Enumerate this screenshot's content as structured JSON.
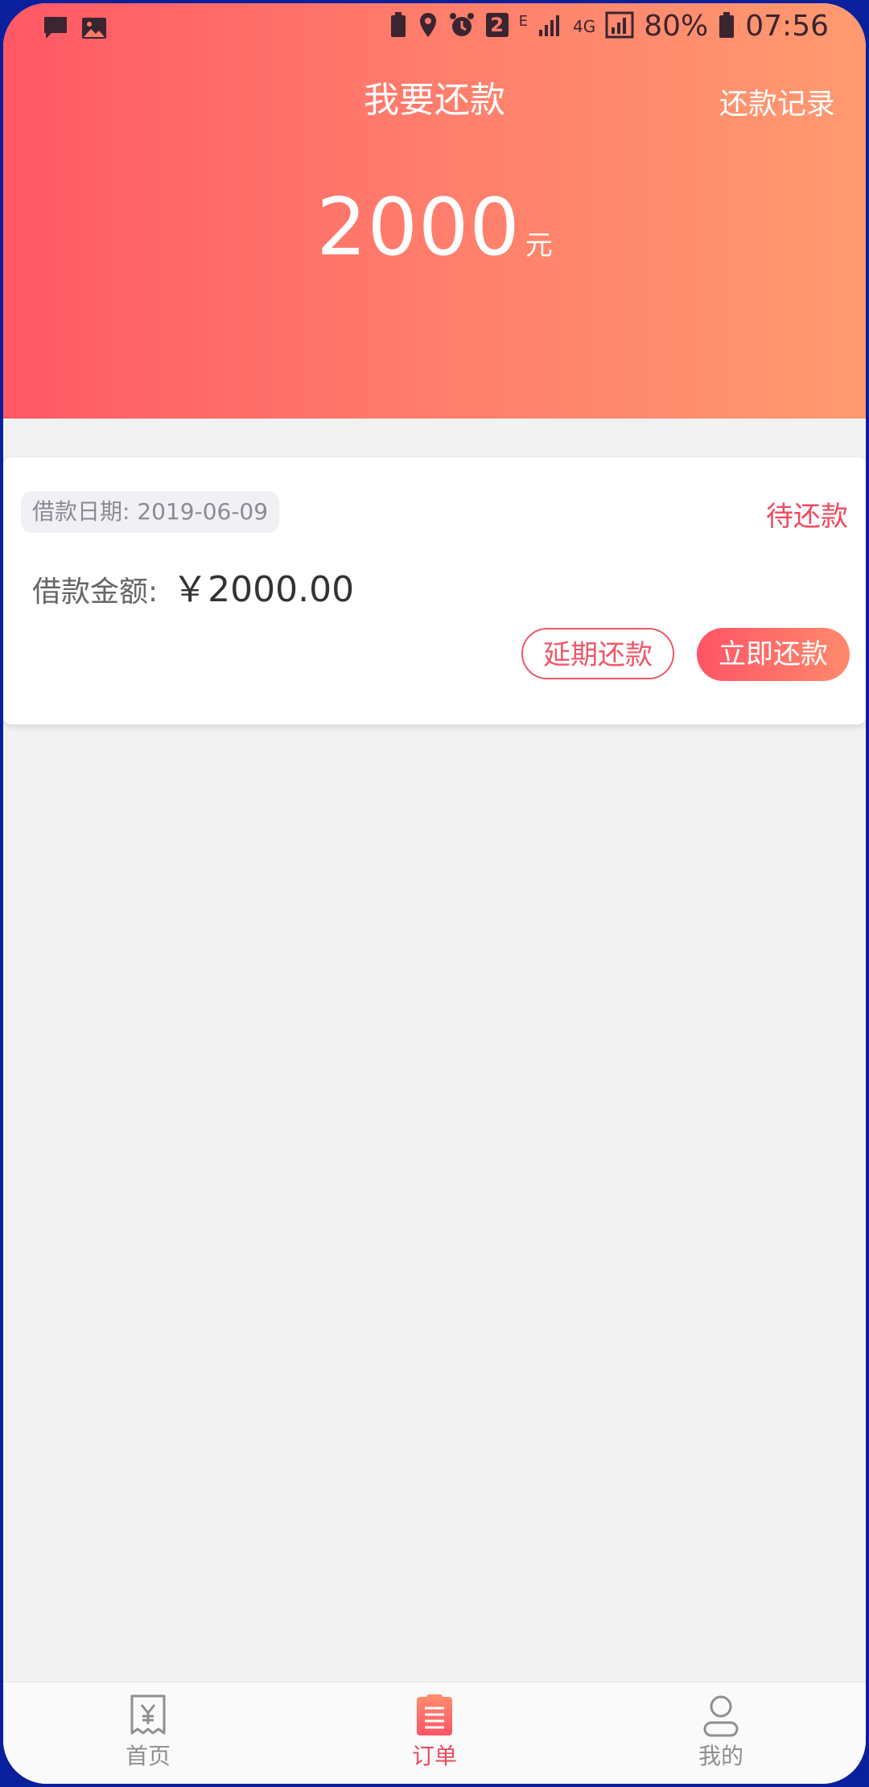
{
  "statusbar": {
    "battery_percent": "80%",
    "time": "07:56",
    "notification_badge": "2",
    "network_label": "4G",
    "edge_label": "E"
  },
  "header": {
    "title": "我要还款",
    "record_link": "还款记录",
    "amount": "2000",
    "unit": "元"
  },
  "card": {
    "date_label": "借款日期: 2019-06-09",
    "status": "待还款",
    "amount_label": "借款金额:",
    "amount_value": "￥2000.00",
    "defer_button": "延期还款",
    "pay_button": "立即还款"
  },
  "nav": {
    "items": [
      {
        "label": "首页",
        "icon": "receipt-yen-icon"
      },
      {
        "label": "订单",
        "icon": "order-list-icon"
      },
      {
        "label": "我的",
        "icon": "user-icon"
      }
    ]
  },
  "colors": {
    "accent": "#ee4a5e",
    "gradient_start": "#ff5866",
    "gradient_end": "#ff9a70"
  }
}
